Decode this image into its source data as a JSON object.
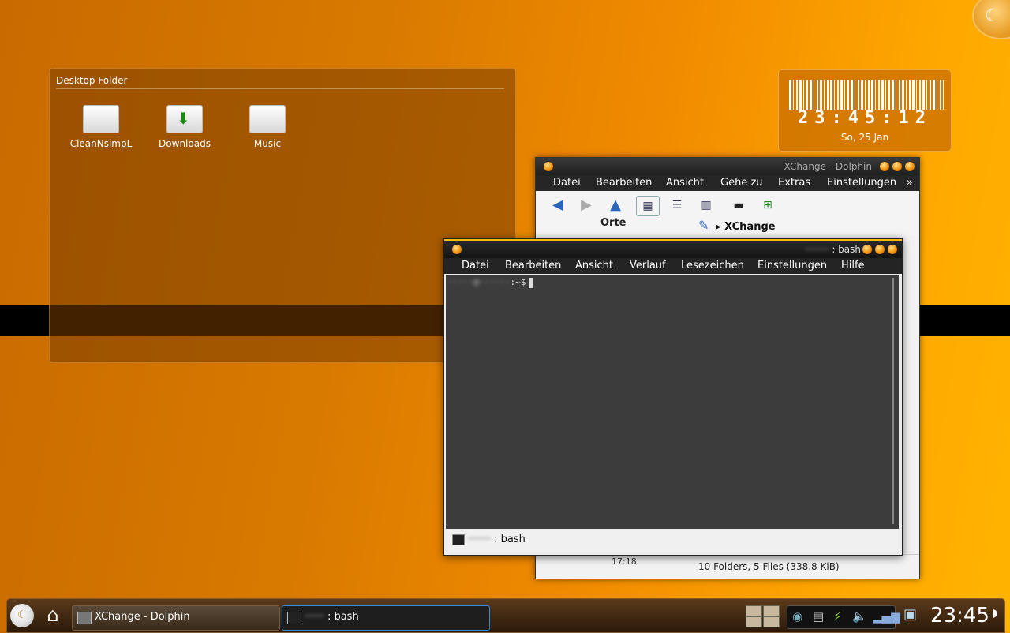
{
  "desktop_folder": {
    "title": "Desktop Folder",
    "items": [
      {
        "label": "CleanNsimpL",
        "icon": "folder-icon"
      },
      {
        "label": "Downloads",
        "icon": "folder-download-icon"
      },
      {
        "label": "Music",
        "icon": "folder-icon"
      }
    ]
  },
  "clock_widget": {
    "time": "23:45:12",
    "date": "So, 25 Jan"
  },
  "dolphin": {
    "title": "XChange - Dolphin",
    "menu": [
      "Datei",
      "Bearbeiten",
      "Ansicht",
      "Gehe zu",
      "Extras",
      "Einstellungen",
      "»"
    ],
    "places_label": "Orte",
    "breadcrumb": "XChange",
    "status": "10 Folders, 5 Files (338.8 KiB)",
    "time_partial": "17:18"
  },
  "konsole": {
    "title_user": "········",
    "title_suffix": ": bash",
    "menu": [
      "Datei",
      "Bearbeiten",
      "Ansicht",
      "Verlauf",
      "Lesezeichen",
      "Einstellungen",
      "Hilfe"
    ],
    "prompt_user": "·····@······",
    "prompt_suffix": ":~$",
    "tab_user": "·······",
    "tab_suffix": ": bash"
  },
  "taskbar": {
    "tasks": [
      {
        "label": "XChange - Dolphin"
      },
      {
        "user": "······",
        "label": ": bash"
      }
    ],
    "clock": "23:45"
  },
  "colors": {
    "accent": "#f08a00",
    "terminal_bg": "#3c3c3c",
    "active_task_border": "#3a8ad8"
  }
}
